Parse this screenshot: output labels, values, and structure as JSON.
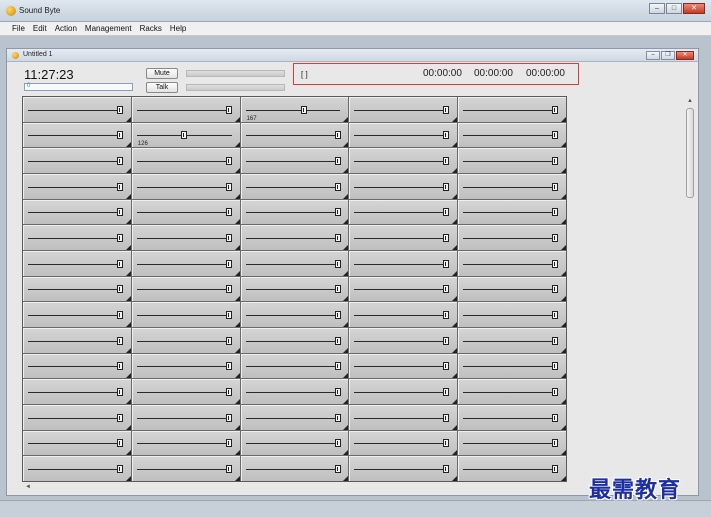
{
  "app": {
    "title": "Sound Byte"
  },
  "window_controls": {
    "minimize": "–",
    "maximize": "□",
    "close": "✕"
  },
  "menu": [
    "File",
    "Edit",
    "Action",
    "Management",
    "Racks",
    "Help"
  ],
  "child": {
    "title": "Untitled 1",
    "controls": {
      "minimize": "–",
      "restore": "❐",
      "close": "✕"
    }
  },
  "header": {
    "clock": "11:27:23",
    "progress_value": "0",
    "progress_fraction": 0.0,
    "mute_label": "Mute",
    "talk_label": "Talk",
    "timer_bracket": "[ ]",
    "timers": [
      "00:00:00",
      "00:00:00",
      "00:00:00"
    ]
  },
  "grid": {
    "columns": 5,
    "rows": 15,
    "default_level": 0.97,
    "special_cells": [
      {
        "row": 0,
        "col": 2,
        "level": 0.62,
        "label": "167"
      },
      {
        "row": 1,
        "col": 1,
        "level": 0.5,
        "label": "126"
      }
    ]
  },
  "scroll": {
    "up": "▲",
    "down": "▼",
    "left": "◄"
  },
  "watermark": "最需教育",
  "icons": {
    "app": "speaker-icon",
    "child": "document-icon"
  }
}
